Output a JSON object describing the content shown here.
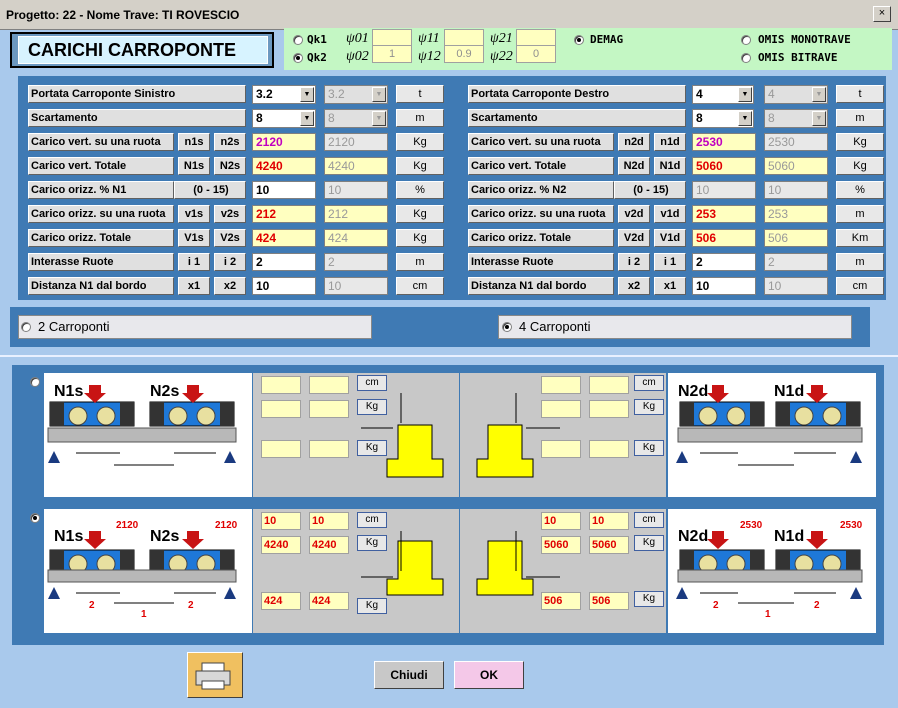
{
  "window": {
    "title": "Progetto: 22 - Nome Trave: TI ROVESCIO",
    "close": "×"
  },
  "header": {
    "title": "CARICHI CARROPONTE"
  },
  "qk": {
    "qk1": "Qk1",
    "qk2": "Qk2",
    "psi01": "ψ01",
    "psi02": "ψ02",
    "psi11": "ψ11",
    "psi12": "ψ12",
    "psi21": "ψ21",
    "psi22": "ψ22",
    "v02": "1",
    "v12": "0.9",
    "v22": "0",
    "demag": "DEMAG",
    "monotrave": "OMIS MONOTRAVE",
    "bitrave": "OMIS BITRAVE"
  },
  "left": {
    "portata": "Portata Carroponte Sinistro",
    "portata_val": "3.2",
    "portata_val2": "3.2",
    "portata_unit": "t",
    "scart": "Scartamento",
    "scart_val": "8",
    "scart_val2": "8",
    "scart_unit": "m",
    "cvr": "Carico vert. su una ruota",
    "cvr_a": "n1s",
    "cvr_b": "n2s",
    "cvr_val": "2120",
    "cvr_val2": "2120",
    "cvr_unit": "Kg",
    "cvt": "Carico vert. Totale",
    "cvt_a": "N1s",
    "cvt_b": "N2s",
    "cvt_val": "4240",
    "cvt_val2": "4240",
    "cvt_unit": "Kg",
    "co": "Carico orizz.   %  N1",
    "co_range": "(0 - 15)",
    "co_val": "10",
    "co_val2": "10",
    "co_unit": "%",
    "cor": "Carico orizz. su una ruota",
    "cor_a": "v1s",
    "cor_b": "v2s",
    "cor_val": "212",
    "cor_val2": "212",
    "cor_unit": "Kg",
    "cot": "Carico orizz. Totale",
    "cot_a": "V1s",
    "cot_b": "V2s",
    "cot_val": "424",
    "cot_val2": "424",
    "cot_unit": "Kg",
    "ir": "Interasse Ruote",
    "ir_a": "i 1",
    "ir_b": "i 2",
    "ir_val": "2",
    "ir_val2": "2",
    "ir_unit": "m",
    "dist": "Distanza N1 dal bordo",
    "dist_a": "x1",
    "dist_b": "x2",
    "dist_val": "10",
    "dist_val2": "10",
    "dist_unit": "cm"
  },
  "right": {
    "portata": "Portata Carroponte Destro",
    "portata_val": "4",
    "portata_val2": "4",
    "portata_unit": "t",
    "scart": "Scartamento",
    "scart_val": "8",
    "scart_val2": "8",
    "scart_unit": "m",
    "cvr": "Carico vert. su una ruota",
    "cvr_a": "n2d",
    "cvr_b": "n1d",
    "cvr_val": "2530",
    "cvr_val2": "2530",
    "cvr_unit": "Kg",
    "cvt": "Carico vert. Totale",
    "cvt_a": "N2d",
    "cvt_b": "N1d",
    "cvt_val": "5060",
    "cvt_val2": "5060",
    "cvt_unit": "Kg",
    "co": "Carico orizz.   %  N2",
    "co_range": "(0 - 15)",
    "co_val": "10",
    "co_val2": "10",
    "co_unit": "%",
    "cor": "Carico orizz. su una ruota",
    "cor_a": "v2d",
    "cor_b": "v1d",
    "cor_val": "253",
    "cor_val2": "253",
    "cor_unit": "m",
    "cot": "Carico orizz. Totale",
    "cot_a": "V2d",
    "cot_b": "V1d",
    "cot_val": "506",
    "cot_val2": "506",
    "cot_unit": "Km",
    "ir": "Interasse Ruote",
    "ir_a": "i 2",
    "ir_b": "i 1",
    "ir_val": "2",
    "ir_val2": "2",
    "ir_unit": "m",
    "dist": "Distanza N1 dal bordo",
    "dist_a": "x2",
    "dist_b": "x1",
    "dist_val": "10",
    "dist_val2": "10",
    "dist_unit": "cm"
  },
  "options": {
    "opt2": "2 Carroponti",
    "opt4": "4 Carroponti"
  },
  "diag": {
    "n1s": "N1s",
    "n2s": "N2s",
    "n2d": "N2d",
    "n1d": "N1d",
    "cm": "cm",
    "kg": "Kg",
    "l_n": "2120",
    "r_n": "2530",
    "l_x1": "10",
    "l_x2": "10",
    "l_n1": "4240",
    "l_n2": "4240",
    "l_v1": "424",
    "l_v2": "424",
    "r_x1": "10",
    "r_x2": "10",
    "r_n1": "5060",
    "r_n2": "5060",
    "r_v1": "506",
    "r_v2": "506",
    "i2": "2",
    "i1": "1"
  },
  "buttons": {
    "chiudi": "Chiudi",
    "ok": "OK"
  },
  "colors": {
    "panel": "#3f7ab4",
    "bg": "#a9c9ec",
    "yellow": "#ffff00",
    "arrow": "#c81414",
    "ok": "#f4c8e8"
  }
}
